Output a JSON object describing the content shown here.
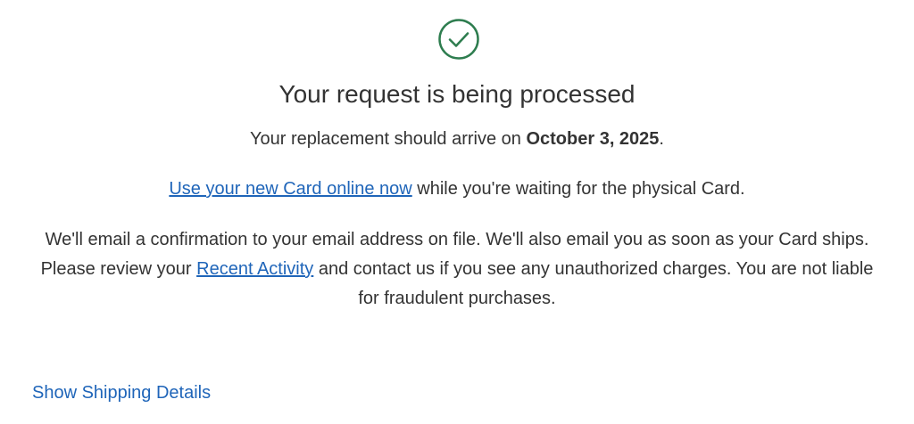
{
  "status": {
    "icon": "check-circle-icon",
    "icon_color": "#2e7d4f",
    "title": "Your request is being processed"
  },
  "arrival": {
    "prefix": "Your replacement should arrive on ",
    "date": "October 3, 2025",
    "suffix": "."
  },
  "online": {
    "link_text": "Use your new Card online now",
    "suffix": " while you're waiting for the physical Card."
  },
  "notice": {
    "part1": "We'll email a confirmation to your email address on file. We'll also email you as soon as your Card ships. Please review your ",
    "link_text": "Recent Activity",
    "part2": " and contact us if you see any unauthorized charges. You are not liable for fraudulent purchases."
  },
  "shipping": {
    "label": "Show Shipping Details"
  },
  "colors": {
    "link": "#1f65b9",
    "text": "#333333"
  }
}
